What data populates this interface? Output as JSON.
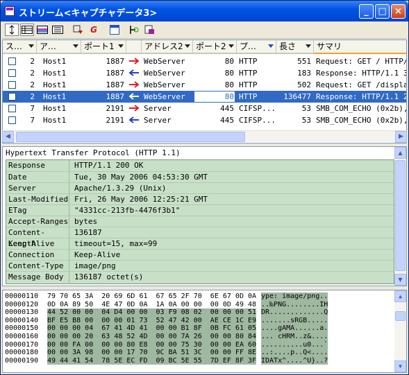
{
  "window": {
    "title": "ストリーム<キャプチャデータ3>",
    "min": "_",
    "max": "□",
    "close": "×"
  },
  "toolbar": {
    "buttons": [
      "sort-icon",
      "table-icon",
      "color-table-icon",
      "list-icon",
      "export-icon",
      "goto-icon",
      "window-icon",
      "decode-icon",
      "save-icon"
    ]
  },
  "list": {
    "columns": [
      "ス…",
      "ア…",
      "ポート1",
      "",
      "アドレス2",
      "ポート2",
      "プ…",
      "長さ",
      "サマリ"
    ],
    "rows": [
      {
        "num": "2",
        "addr1": "Host1",
        "port1": "1887",
        "dir": "right",
        "addr2": "WebServer",
        "port2": "80",
        "proto": "HTTP",
        "len": "551",
        "summary": "Request: GET / HTTP/1.",
        "sel": false
      },
      {
        "num": "2",
        "addr1": "Host1",
        "port1": "1887",
        "dir": "left",
        "addr2": "WebServer",
        "port2": "80",
        "proto": "HTTP",
        "len": "183",
        "summary": "Response: HTTP/1.1 304",
        "sel": false
      },
      {
        "num": "2",
        "addr1": "Host1",
        "port1": "1887",
        "dir": "right",
        "addr2": "WebServer",
        "port2": "80",
        "proto": "HTTP",
        "len": "502",
        "summary": "Request: GET /display/",
        "sel": false
      },
      {
        "num": "2",
        "addr1": "Host1",
        "port1": "1887",
        "dir": "left",
        "addr2": "WebServer",
        "port2": "80",
        "proto": "HTTP",
        "len": "136477",
        "summary": "Response: HTTP/1.1 200",
        "sel": true
      },
      {
        "num": "7",
        "addr1": "Host1",
        "port1": "2191",
        "dir": "right",
        "addr2": "Server",
        "port2": "445",
        "proto": "CIFSP...",
        "len": "53",
        "summary": "SMB_COM_ECHO (0x2b), c",
        "sel": false
      },
      {
        "num": "7",
        "addr1": "Host1",
        "port1": "2191",
        "dir": "left",
        "addr2": "Server",
        "port2": "445",
        "proto": "CIFSP...",
        "len": "53",
        "summary": "SMB_COM_ECHO (0x2b), s",
        "sel": false
      }
    ]
  },
  "detail": {
    "title": "Hypertext Transfer Protocol (HTTP 1.1)",
    "fields": [
      {
        "k": "Response",
        "v": "HTTP/1.1 200 OK"
      },
      {
        "k": "Date",
        "v": "Tue, 30 May 2006 04:53:30 GMT"
      },
      {
        "k": "Server",
        "v": "Apache/1.3.29 (Unix)"
      },
      {
        "k": "Last-Modified",
        "v": "Fri, 26 May 2006 12:25:21 GMT"
      },
      {
        "k": "ETag",
        "v": "\"4331cc-213fb-4476f3b1\""
      },
      {
        "k": "Accept-Ranges",
        "v": "bytes"
      },
      {
        "k": "Content-Length",
        "v": "136187"
      },
      {
        "k": "Keep-Alive",
        "v": "timeout=15, max=99"
      },
      {
        "k": "Connection",
        "v": "Keep-Alive"
      },
      {
        "k": "Content-Type",
        "v": "image/png"
      },
      {
        "k": "Message Body",
        "v": "136187 octet(s)"
      }
    ]
  },
  "hex": {
    "rows": [
      {
        "off": "00000110",
        "bytes": "79 70 65 3A  20 69 6D 61  67 65 2F 70  6E 67 0D 0A",
        "asc": "ype: image/png.."
      },
      {
        "off": "00000120",
        "bytes": "0D 0A 89 50  4E 47 0D 0A  1A 0A 00 00  00 0D 49 48",
        "asc": "..‰PNG........IH"
      },
      {
        "off": "00000130",
        "bytes": "44 52 00 00  04 D4 00 00  03 F9 08 02  00 00 00 51",
        "asc": "DR.............Q"
      },
      {
        "off": "00000140",
        "bytes": "BF E5 B8 00  00 00 01 73  52 47 42 00  AE CE 1C E9",
        "asc": ".......sRGB....."
      },
      {
        "off": "00000150",
        "bytes": "00 00 00 04  67 41 4D 41  00 00 B1 8F  0B FC 61 05",
        "asc": "....gAMA......a."
      },
      {
        "off": "00000160",
        "bytes": "00 00 00 20  63 48 52 4D  00 00 7A 26  00 00 80 84",
        "asc": "... cHRM..z&...."
      },
      {
        "off": "00000170",
        "bytes": "00 00 FA 00  00 00 80 E8  00 00 75 30  00 00 EA 60",
        "asc": "..........u0...`"
      },
      {
        "off": "00000180",
        "bytes": "00 00 3A 98  00 00 17 70  9C BA 51 3C  00 00 FF 8E",
        "asc": "..:....p..Q<...."
      },
      {
        "off": "00000190",
        "bytes": "49 44 41 54  78 5E EC FD  09 BC 5E 55  7D EF 8F 3F",
        "asc": "IDATx^....^U}..?"
      }
    ]
  }
}
